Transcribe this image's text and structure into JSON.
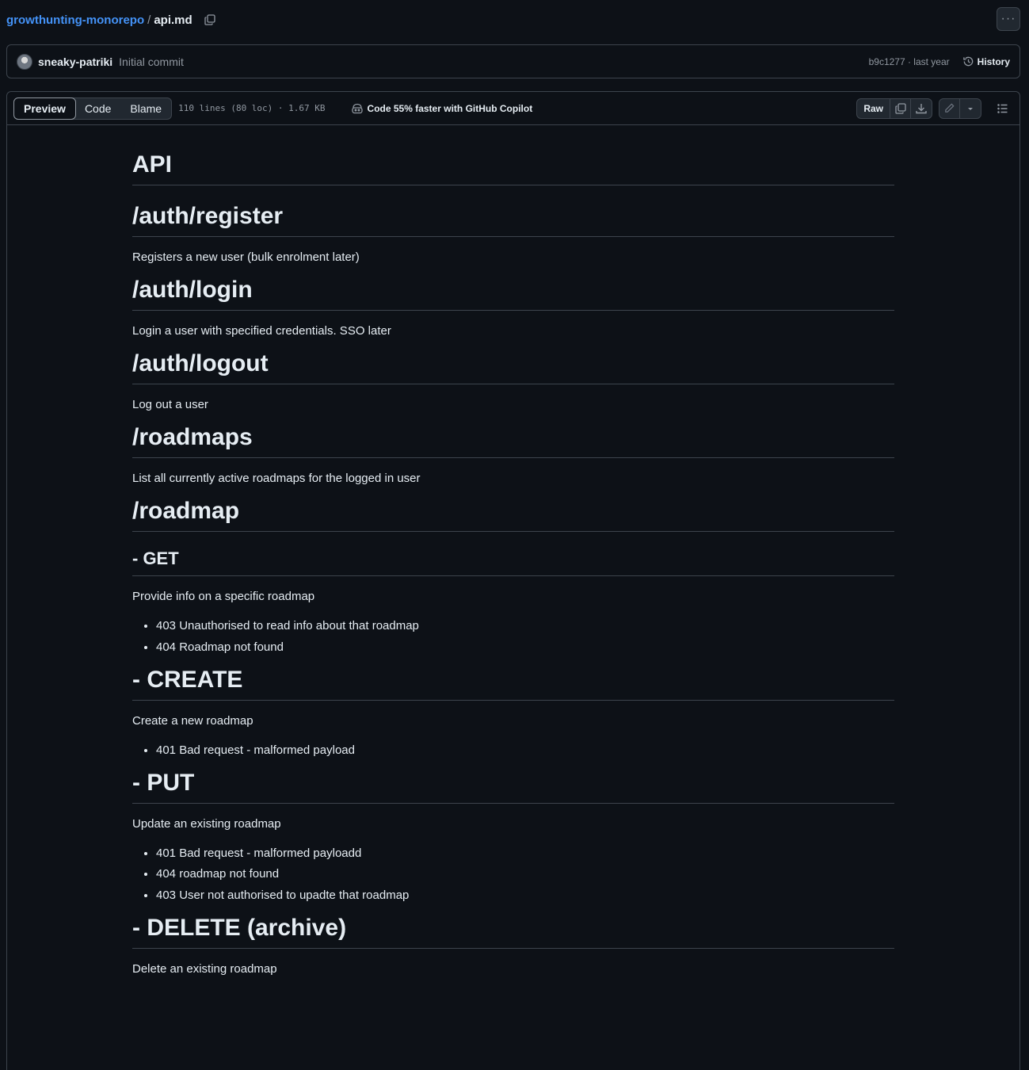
{
  "path": {
    "repo": "growthunting-monorepo",
    "separator": "/",
    "file": "api.md"
  },
  "more_button": "···",
  "commit": {
    "author": "sneaky-patriki",
    "message": "Initial commit",
    "meta": "b9c1277 · last year",
    "history_label": "History"
  },
  "toolbar": {
    "tabs": [
      "Preview",
      "Code",
      "Blame"
    ],
    "file_info": "110 lines (80 loc) · 1.67 KB",
    "copilot_label": "Code 55% faster with GitHub Copilot",
    "raw_label": "Raw"
  },
  "icons": [
    "copy-icon",
    "more-icon",
    "history-icon",
    "copilot-icon",
    "download-icon",
    "pencil-icon",
    "triangle-down-icon",
    "list-icon"
  ],
  "markdown": [
    {
      "type": "h1",
      "text": "API"
    },
    {
      "type": "h1",
      "text": "/auth/register"
    },
    {
      "type": "p",
      "text": "Registers a new user (bulk enrolment later)"
    },
    {
      "type": "h1",
      "text": "/auth/login"
    },
    {
      "type": "p",
      "text": "Login a user with specified credentials. SSO later"
    },
    {
      "type": "h1",
      "text": "/auth/logout"
    },
    {
      "type": "p",
      "text": "Log out a user"
    },
    {
      "type": "h1",
      "text": "/roadmaps"
    },
    {
      "type": "p",
      "text": "List all currently active roadmaps for the logged in user"
    },
    {
      "type": "h1",
      "text": "/roadmap"
    },
    {
      "type": "h2",
      "text": "- GET"
    },
    {
      "type": "p",
      "text": "Provide info on a specific roadmap"
    },
    {
      "type": "ul",
      "items": [
        "403 Unauthorised to read info about that roadmap",
        "404 Roadmap not found"
      ]
    },
    {
      "type": "h1",
      "text": "- CREATE"
    },
    {
      "type": "p",
      "text": "Create a new roadmap"
    },
    {
      "type": "ul",
      "items": [
        "401 Bad request - malformed payload"
      ]
    },
    {
      "type": "h1",
      "text": "- PUT"
    },
    {
      "type": "p",
      "text": "Update an existing roadmap"
    },
    {
      "type": "ul",
      "items": [
        "401 Bad request - malformed payloadd",
        "404 roadmap not found",
        "403 User not authorised to upadte that roadmap"
      ]
    },
    {
      "type": "h1",
      "text": "- DELETE (archive)"
    },
    {
      "type": "p",
      "text": "Delete an existing roadmap"
    }
  ]
}
